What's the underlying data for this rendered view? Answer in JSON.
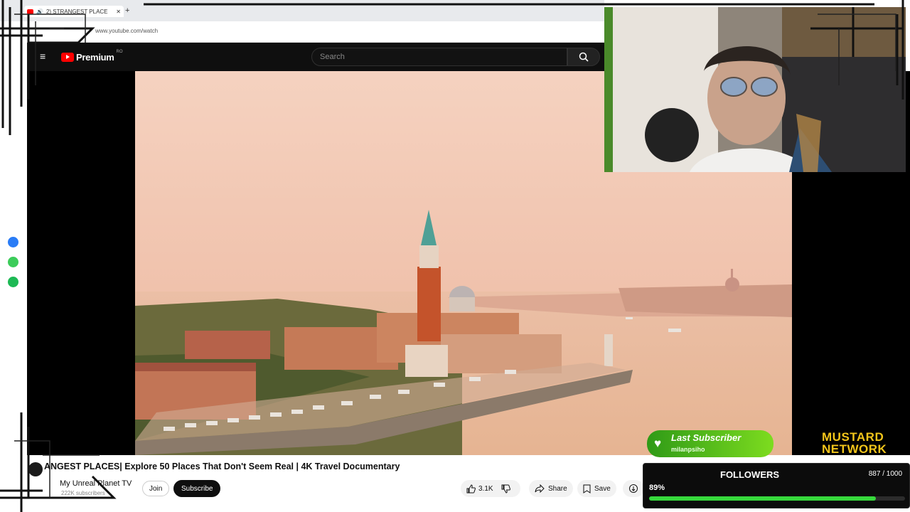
{
  "browser": {
    "tab_title": "2) STRANGEST PLACE",
    "new_tab": "+",
    "url": "www.youtube.com/watch"
  },
  "youtube": {
    "logo_text": "Premium",
    "logo_country": "RO",
    "search_placeholder": "Search"
  },
  "video": {
    "title": "ANGEST PLACES| Explore 50 Places That Don't Seem Real | 4K Travel Documentary",
    "channel": "My Unreal Planet TV",
    "subscribers": "222K subscribers",
    "join_label": "Join",
    "subscribe_label": "Subscribe",
    "likes": "3.1K",
    "share_label": "Share",
    "save_label": "Save"
  },
  "overlay": {
    "last_subscriber_label": "Last Subscriber",
    "last_subscriber_name": "milanpsiho",
    "network_line1": "MUSTARD",
    "network_line2": "NETWORK",
    "followers_title": "FOLLOWERS",
    "followers_count": "887 / 1000",
    "followers_percent": "89%",
    "followers_fraction": 0.887
  },
  "colors": {
    "accent_red": "#ff0000",
    "progress_green": "#37d93c",
    "mustard": "#f2c51a"
  }
}
